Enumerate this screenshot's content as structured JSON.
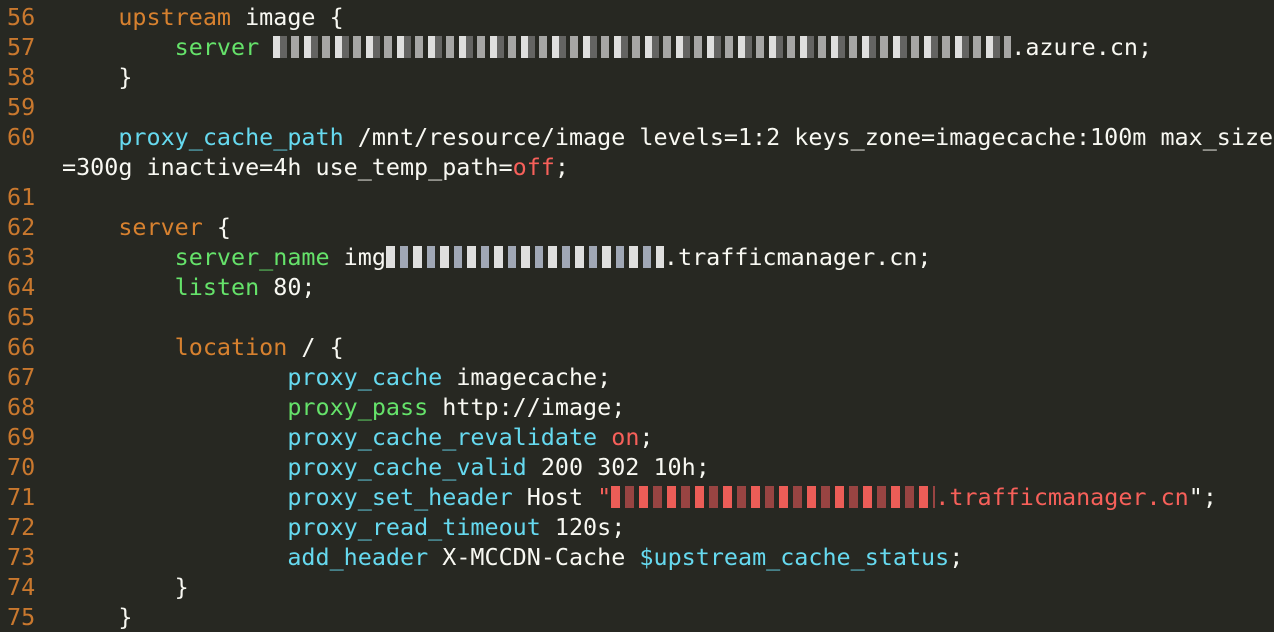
{
  "editor": {
    "lines": [
      {
        "n": "56",
        "indent": "    ",
        "tokens": [
          {
            "c": "kw-orange",
            "t": "upstream"
          },
          {
            "c": "txt",
            "t": " image {"
          }
        ]
      },
      {
        "n": "57",
        "indent": "        ",
        "tokens": [
          {
            "c": "kw-green",
            "t": "server"
          },
          {
            "c": "txt",
            "t": " "
          },
          {
            "c": "redact redact-white",
            "t": ""
          },
          {
            "c": "txt",
            "t": ".azure.cn;"
          }
        ]
      },
      {
        "n": "58",
        "indent": "    ",
        "tokens": [
          {
            "c": "txt",
            "t": "}"
          }
        ]
      },
      {
        "n": "59",
        "indent": "",
        "tokens": []
      },
      {
        "n": "60",
        "indent": "    ",
        "tokens": [
          {
            "c": "kw-cyan",
            "t": "proxy_cache_path"
          },
          {
            "c": "txt",
            "t": " /mnt/resource/image levels=1:2 keys_zone=imagecache:100m max_size"
          }
        ]
      },
      {
        "n": "",
        "indent": "",
        "tokens": [
          {
            "c": "txt",
            "t": "=300g inactive=4h use_temp_path="
          },
          {
            "c": "val-red",
            "t": "off"
          },
          {
            "c": "txt",
            "t": ";"
          }
        ]
      },
      {
        "n": "61",
        "indent": "",
        "tokens": []
      },
      {
        "n": "62",
        "indent": "    ",
        "tokens": [
          {
            "c": "kw-orange",
            "t": "server"
          },
          {
            "c": "txt",
            "t": " {"
          }
        ]
      },
      {
        "n": "63",
        "indent": "        ",
        "tokens": [
          {
            "c": "kw-green",
            "t": "server_name"
          },
          {
            "c": "txt",
            "t": " img"
          },
          {
            "c": "redact redact-host",
            "t": ""
          },
          {
            "c": "txt",
            "t": ".trafficmanager.cn;"
          }
        ]
      },
      {
        "n": "64",
        "indent": "        ",
        "tokens": [
          {
            "c": "kw-green",
            "t": "listen"
          },
          {
            "c": "txt",
            "t": " 80;"
          }
        ]
      },
      {
        "n": "65",
        "indent": "",
        "tokens": []
      },
      {
        "n": "66",
        "indent": "        ",
        "tokens": [
          {
            "c": "kw-orange",
            "t": "location"
          },
          {
            "c": "txt",
            "t": " / {"
          }
        ]
      },
      {
        "n": "67",
        "indent": "                ",
        "tokens": [
          {
            "c": "kw-cyan",
            "t": "proxy_cache"
          },
          {
            "c": "txt",
            "t": " imagecache;"
          }
        ]
      },
      {
        "n": "68",
        "indent": "                ",
        "tokens": [
          {
            "c": "kw-green",
            "t": "proxy_pass"
          },
          {
            "c": "txt",
            "t": " http://image;"
          }
        ]
      },
      {
        "n": "69",
        "indent": "                ",
        "tokens": [
          {
            "c": "kw-cyan",
            "t": "proxy_cache_revalidate"
          },
          {
            "c": "txt",
            "t": " "
          },
          {
            "c": "val-red",
            "t": "on"
          },
          {
            "c": "txt",
            "t": ";"
          }
        ]
      },
      {
        "n": "70",
        "indent": "                ",
        "tokens": [
          {
            "c": "kw-cyan",
            "t": "proxy_cache_valid"
          },
          {
            "c": "txt",
            "t": " 200 302 10h;"
          }
        ]
      },
      {
        "n": "71",
        "indent": "                ",
        "tokens": [
          {
            "c": "kw-cyan",
            "t": "proxy_set_header"
          },
          {
            "c": "txt",
            "t": " Host "
          },
          {
            "c": "val-red",
            "t": "\""
          },
          {
            "c": "redact redact-red",
            "t": ""
          },
          {
            "c": "val-red",
            "t": ".trafficmanager.cn"
          },
          {
            "c": "txt",
            "t": "\";"
          }
        ]
      },
      {
        "n": "72",
        "indent": "                ",
        "tokens": [
          {
            "c": "kw-cyan",
            "t": "proxy_read_timeout"
          },
          {
            "c": "txt",
            "t": " 120s;"
          }
        ]
      },
      {
        "n": "73",
        "indent": "                ",
        "tokens": [
          {
            "c": "kw-cyan",
            "t": "add_header"
          },
          {
            "c": "txt",
            "t": " X-MCCDN-Cache "
          },
          {
            "c": "kw-cyan",
            "t": "$upstream_cache_status"
          },
          {
            "c": "txt",
            "t": ";"
          }
        ]
      },
      {
        "n": "74",
        "indent": "        ",
        "tokens": [
          {
            "c": "txt",
            "t": "}"
          }
        ]
      },
      {
        "n": "75",
        "indent": "    ",
        "tokens": [
          {
            "c": "txt",
            "t": "}"
          }
        ]
      }
    ]
  }
}
